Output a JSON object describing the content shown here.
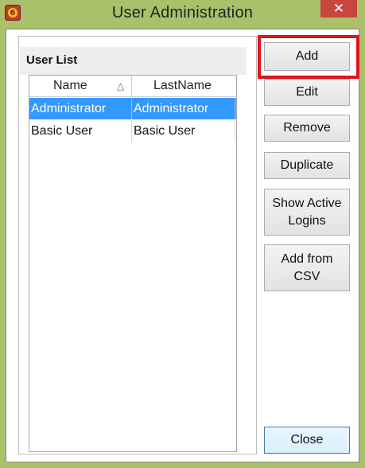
{
  "window": {
    "title": "User Administration",
    "app_icon": "app-logo-icon",
    "app_icon_glyph": "6",
    "close_glyph": "✕",
    "frame_color": "#a9c16b",
    "close_color": "#c7463d"
  },
  "user_list": {
    "title": "User List",
    "columns": [
      {
        "label": "Name",
        "sort_glyph": "△"
      },
      {
        "label": "LastName"
      }
    ],
    "rows": [
      {
        "name": "Administrator",
        "last_name": "Administrator",
        "selected": true
      },
      {
        "name": "Basic User",
        "last_name": "Basic User",
        "selected": false
      }
    ],
    "selection_color": "#3399ff"
  },
  "buttons": {
    "add": "Add",
    "edit": "Edit",
    "remove": "Remove",
    "duplicate": "Duplicate",
    "show_active_logins_line1": "Show Active",
    "show_active_logins_line2": "Logins",
    "add_from_csv_line1": "Add from",
    "add_from_csv_line2": "CSV",
    "close": "Close"
  },
  "highlight_color": "#e0141e"
}
